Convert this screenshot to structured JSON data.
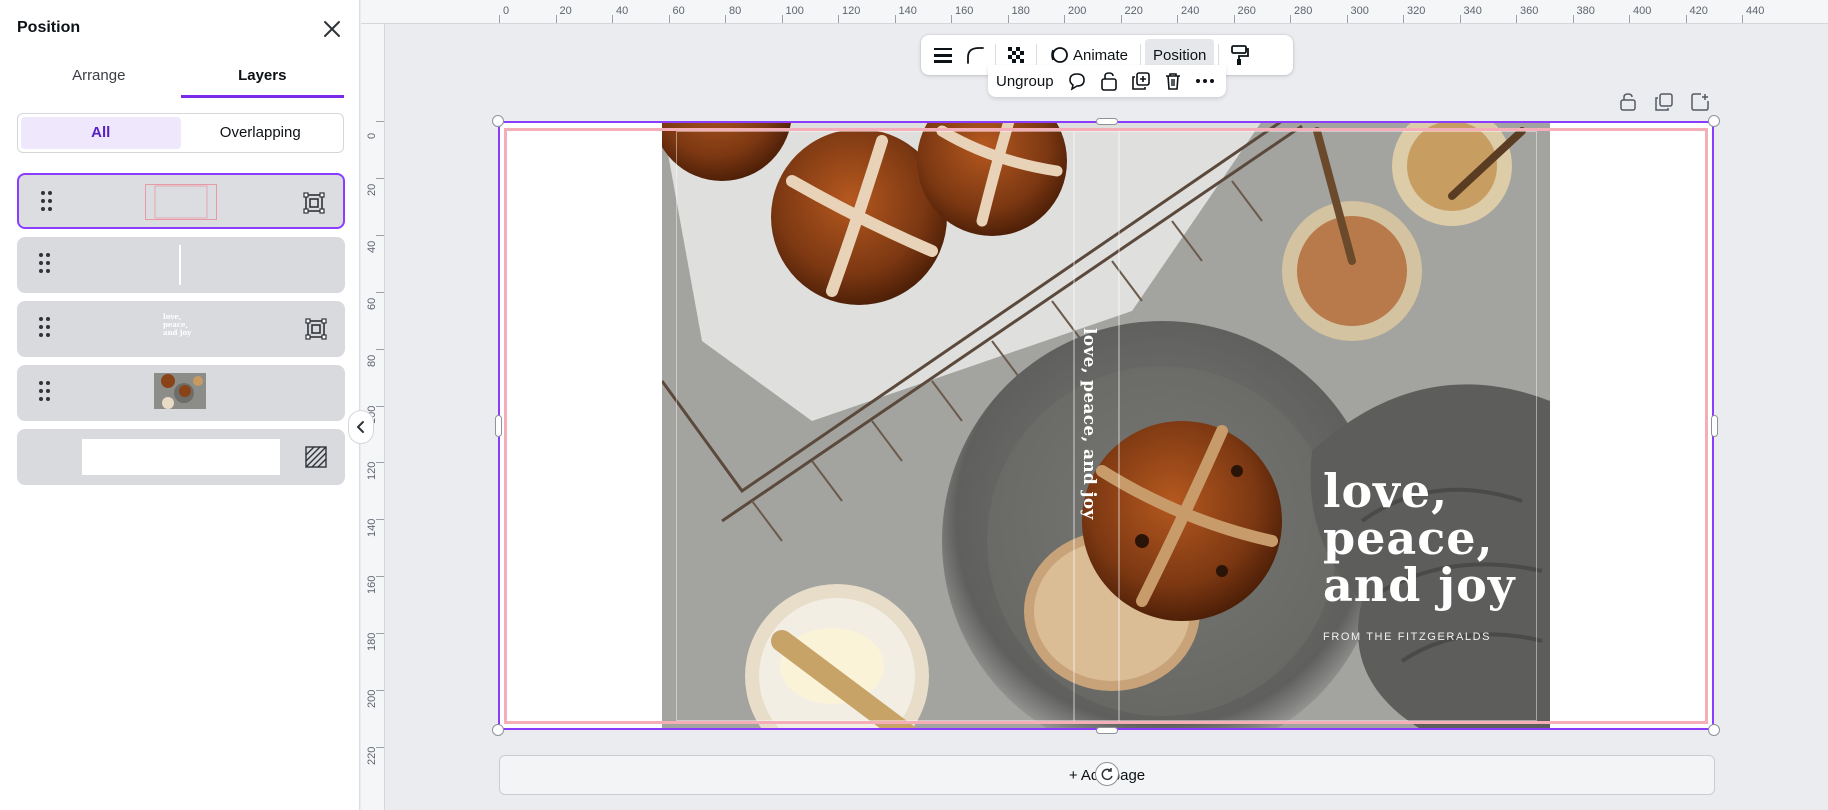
{
  "panel": {
    "title": "Position",
    "tabs": [
      {
        "label": "Arrange",
        "active": false
      },
      {
        "label": "Layers",
        "active": true
      }
    ],
    "filters": [
      {
        "label": "All",
        "active": true
      },
      {
        "label": "Overlapping",
        "active": false
      }
    ],
    "layers": [
      {
        "name": "group-frame",
        "selected": true,
        "icon": "group-icon"
      },
      {
        "name": "vertical-line",
        "selected": false,
        "icon": ""
      },
      {
        "name": "text-group",
        "selected": false,
        "icon": "group-icon",
        "thumb_text": [
          "love,",
          "peace,",
          "and joy"
        ]
      },
      {
        "name": "photo",
        "selected": false,
        "icon": ""
      },
      {
        "name": "background",
        "selected": false,
        "icon": "transparency-icon"
      }
    ]
  },
  "ruler": {
    "top": [
      "0",
      "20",
      "40",
      "60",
      "80",
      "100",
      "120",
      "140",
      "160",
      "180",
      "200",
      "220",
      "240",
      "260",
      "280",
      "300",
      "320",
      "340",
      "360",
      "380",
      "400",
      "420",
      "440"
    ],
    "left": [
      "0",
      "20",
      "40",
      "60",
      "80",
      "100",
      "120",
      "140",
      "160",
      "180",
      "200",
      "220"
    ]
  },
  "toolbar": {
    "animate_label": "Animate",
    "position_label": "Position",
    "ungroup_label": "Ungroup"
  },
  "design": {
    "vertical_text": "love, peace, and joy",
    "headline": [
      "love,",
      "peace,",
      "and joy"
    ],
    "byline": "FROM THE FITZGERALDS"
  },
  "add_page_label": "+  Add page",
  "colors": {
    "accent": "#8b3dff",
    "frame_pink": "#f4aeb8"
  }
}
